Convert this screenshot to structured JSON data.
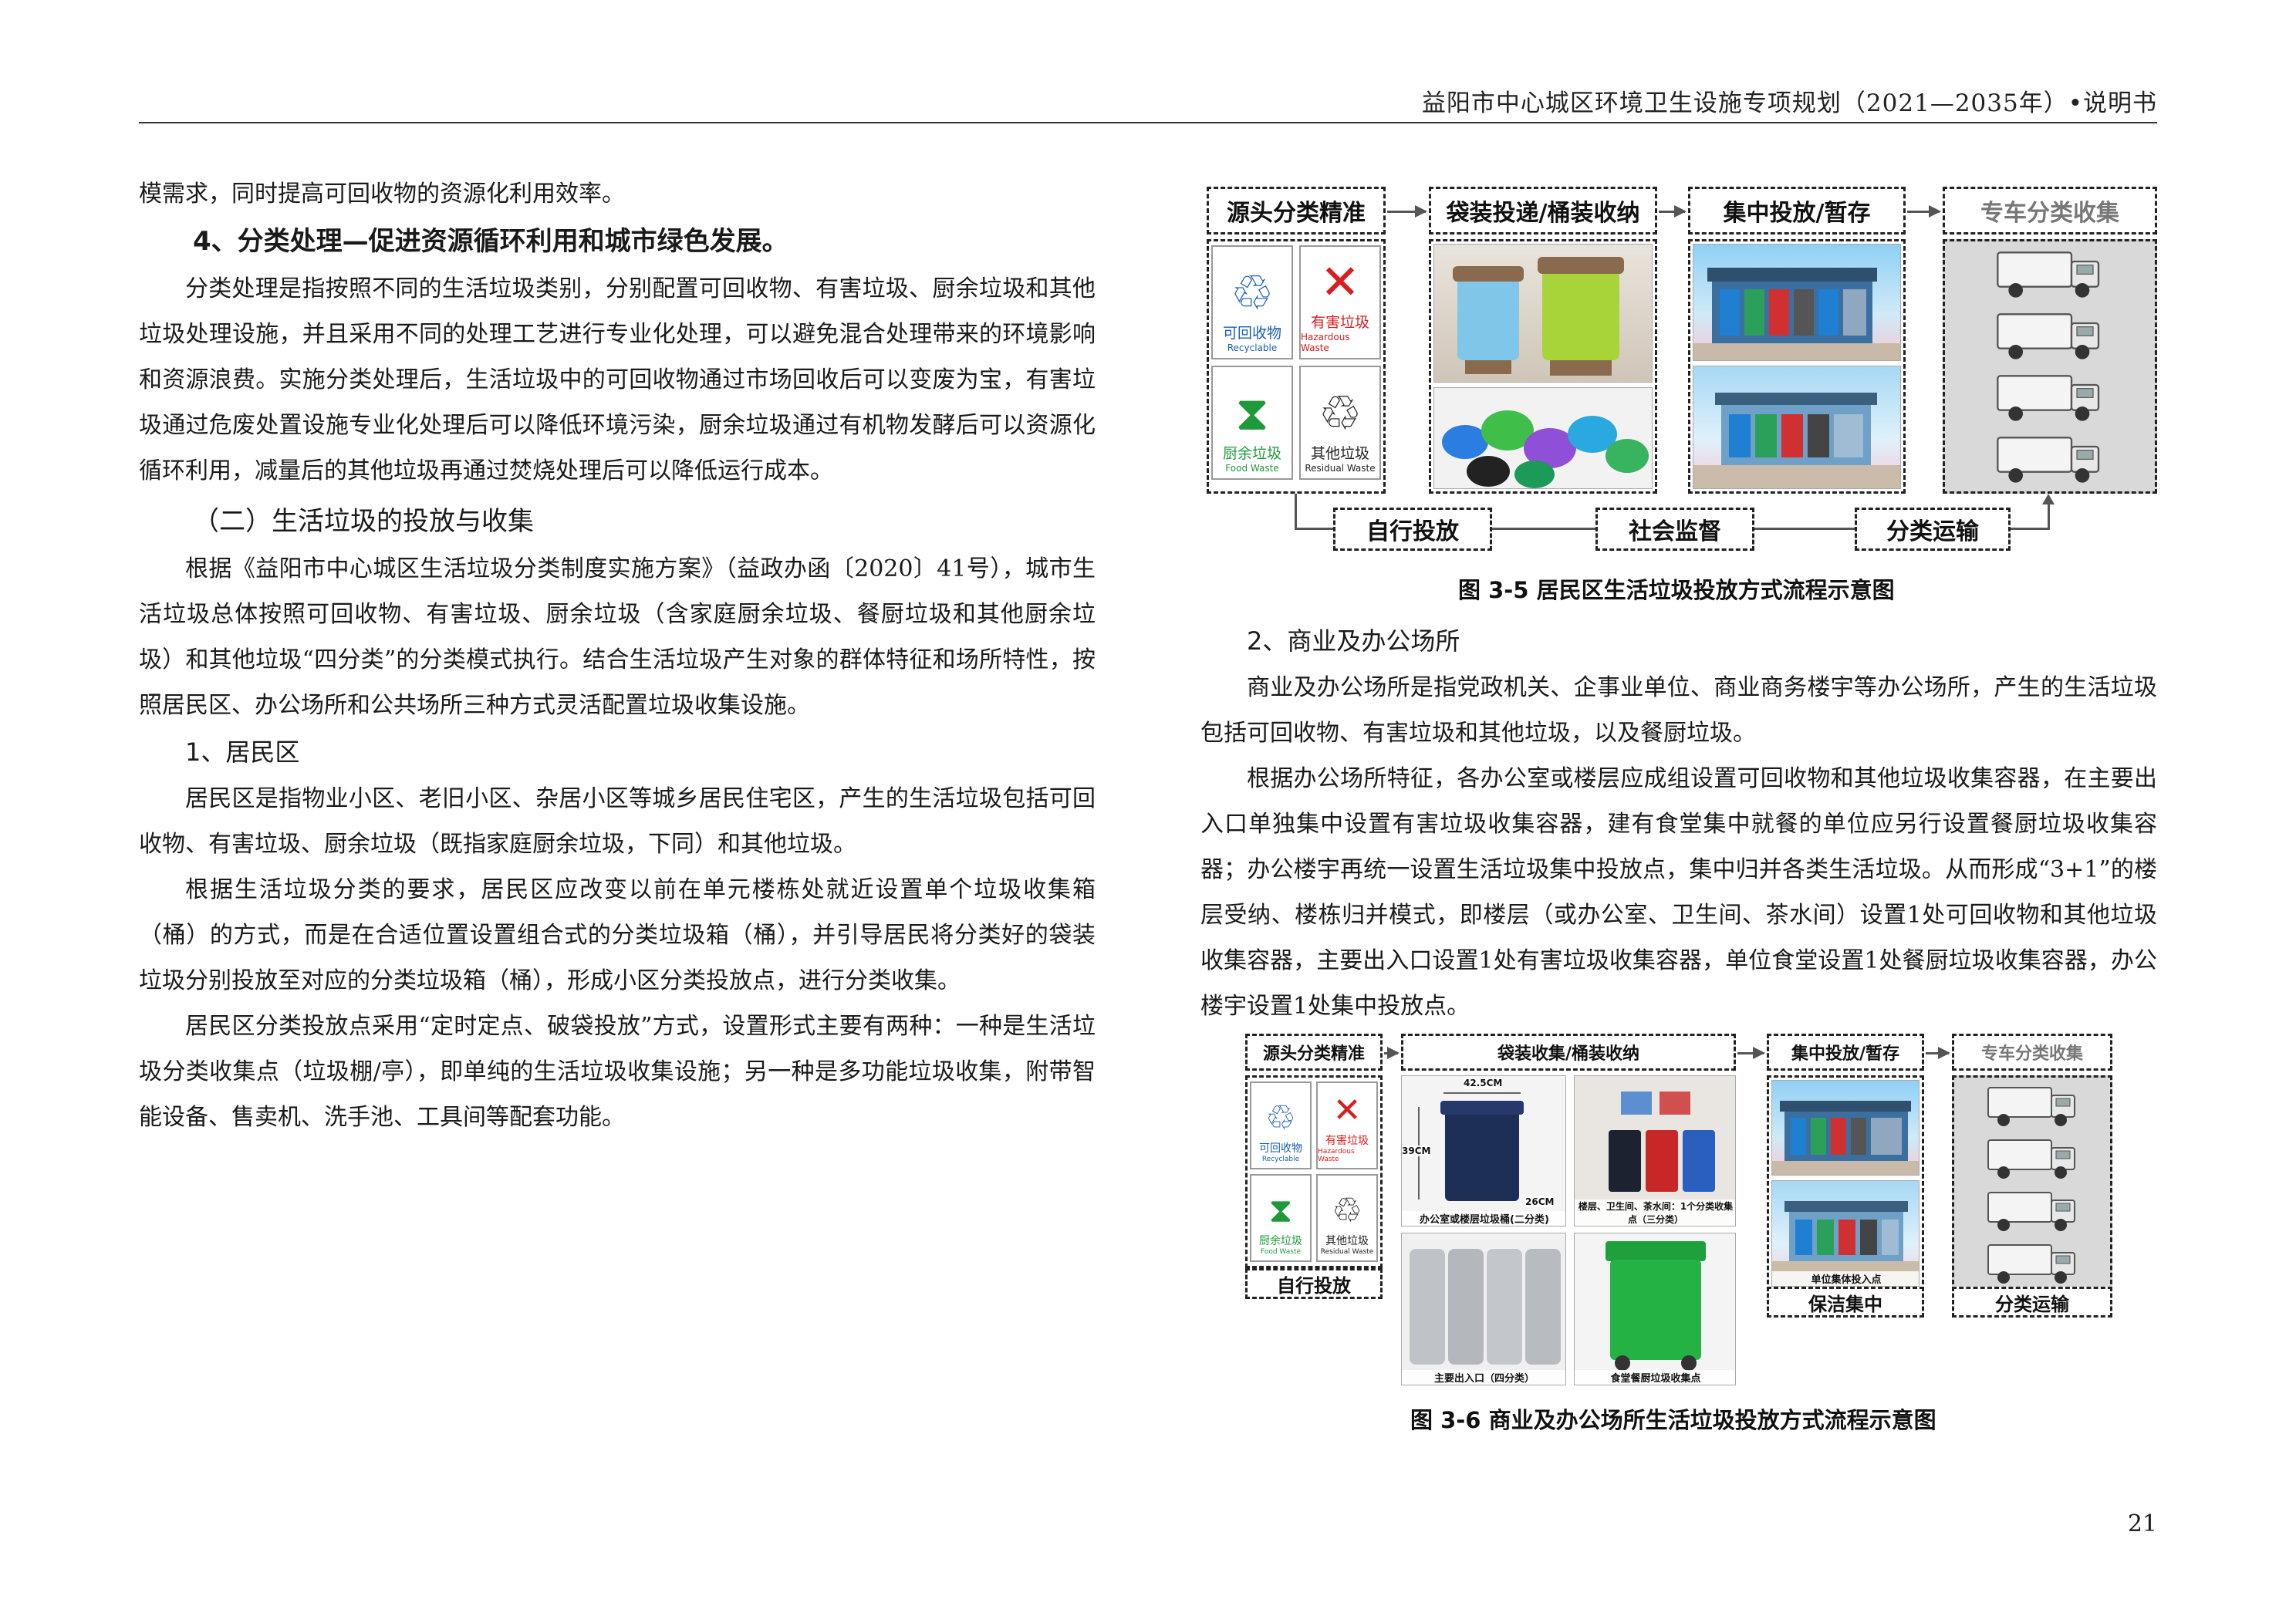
{
  "header": {
    "title": "益阳市中心城区环境卫生设施专项规划（2021—2035年）•说明书"
  },
  "left": {
    "p0": "模需求，同时提高可回收物的资源化利用效率。",
    "h_4": "4、分类处理—促进资源循环利用和城市绿色发展。",
    "p1": "分类处理是指按照不同的生活垃圾类别，分别配置可回收物、有害垃圾、厨余垃圾和其他垃圾处理设施，并且采用不同的处理工艺进行专业化处理，可以避免混合处理带来的环境影响和资源浪费。实施分类处理后，生活垃圾中的可回收物通过市场回收后可以变废为宝，有害垃圾通过危废处置设施专业化处理后可以降低环境污染，厨余垃圾通过有机物发酵后可以资源化循环利用，减量后的其他垃圾再通过焚烧处理后可以降低运行成本。",
    "h_2": "（二）生活垃圾的投放与收集",
    "p2": "根据《益阳市中心城区生活垃圾分类制度实施方案》（益政办函〔2020〕41号），城市生活垃圾总体按照可回收物、有害垃圾、厨余垃圾（含家庭厨余垃圾、餐厨垃圾和其他厨余垃圾）和其他垃圾“四分类”的分类模式执行。结合生活垃圾产生对象的群体特征和场所特性，按照居民区、办公场所和公共场所三种方式灵活配置垃圾收集设施。",
    "h_1": "1、居民区",
    "p3": "居民区是指物业小区、老旧小区、杂居小区等城乡居民住宅区，产生的生活垃圾包括可回收物、有害垃圾、厨余垃圾（既指家庭厨余垃圾，下同）和其他垃圾。",
    "p4": "根据生活垃圾分类的要求，居民区应改变以前在单元楼栋处就近设置单个垃圾收集箱（桶）的方式，而是在合适位置设置组合式的分类垃圾箱（桶），并引导居民将分类好的袋装垃圾分别投放至对应的分类垃圾箱（桶），形成小区分类投放点，进行分类收集。",
    "p5": "居民区分类投放点采用“定时定点、破袋投放”方式，设置形式主要有两种：一种是生活垃圾分类收集点（垃圾棚/亭），即单纯的生活垃圾收集设施；另一种是多功能垃圾收集，附带智能设备、售卖机、洗手池、工具间等配套功能。"
  },
  "fig5": {
    "b1": "源头分类精准",
    "b2": "袋装投递/桶装收纳",
    "b3": "集中投放/暂存",
    "b4": "专车分类收集",
    "bottom1": "自行投放",
    "bottom2": "社会监督",
    "bottom3": "分类运输",
    "caption": "图 3-5  居民区生活垃圾投放方式流程示意图"
  },
  "categories": [
    {
      "cn": "可回收物",
      "en": "Recyclable",
      "color": "#1a5fb4",
      "sym": "♲"
    },
    {
      "cn": "有害垃圾",
      "en": "Hazardous Waste",
      "color": "#d81e1e",
      "sym": "✕"
    },
    {
      "cn": "厨余垃圾",
      "en": "Food Waste",
      "color": "#1f9a3a",
      "sym": "⧗"
    },
    {
      "cn": "其他垃圾",
      "en": "Residual Waste",
      "color": "#222222",
      "sym": "♲"
    }
  ],
  "right": {
    "h_2": "2、商业及办公场所",
    "p1": "商业及办公场所是指党政机关、企事业单位、商业商务楼宇等办公场所，产生的生活垃圾包括可回收物、有害垃圾和其他垃圾，以及餐厨垃圾。",
    "p2": "根据办公场所特征，各办公室或楼层应成组设置可回收物和其他垃圾收集容器，在主要出入口单独集中设置有害垃圾收集容器，建有食堂集中就餐的单位应另行设置餐厨垃圾收集容器；办公楼宇再统一设置生活垃圾集中投放点，集中归并各类生活垃圾。从而形成“3+1”的楼层受纳、楼栋归并模式，即楼层（或办公室、卫生间、茶水间）设置1处可回收物和其他垃圾收集容器，主要出入口设置1处有害垃圾收集容器，单位食堂设置1处餐厨垃圾收集容器，办公楼宇设置1处集中投放点。"
  },
  "fig6": {
    "b1": "源头分类精准",
    "b2": "袋装收集/桶装收纳",
    "b3": "集中投放/暂存",
    "b4": "专车分类收集",
    "l1": "自行投放",
    "l3": "保洁集中",
    "l4": "分类运输",
    "dim_w": "42.5CM",
    "dim_h": "39CM",
    "dim_d": "26CM",
    "cap_a": "办公室或楼层垃圾桶(二分类)",
    "cap_b": "楼层、卫生间、茶水间：1个分类收集点（三分类）",
    "cap_c": "主要出入口（四分类）",
    "cap_d": "食堂餐厨垃圾收集点",
    "cap_e": "单位集体投入点",
    "caption": "图 3-6  商业及办公场所生活垃圾投放方式流程示意图"
  },
  "page_number": "21"
}
